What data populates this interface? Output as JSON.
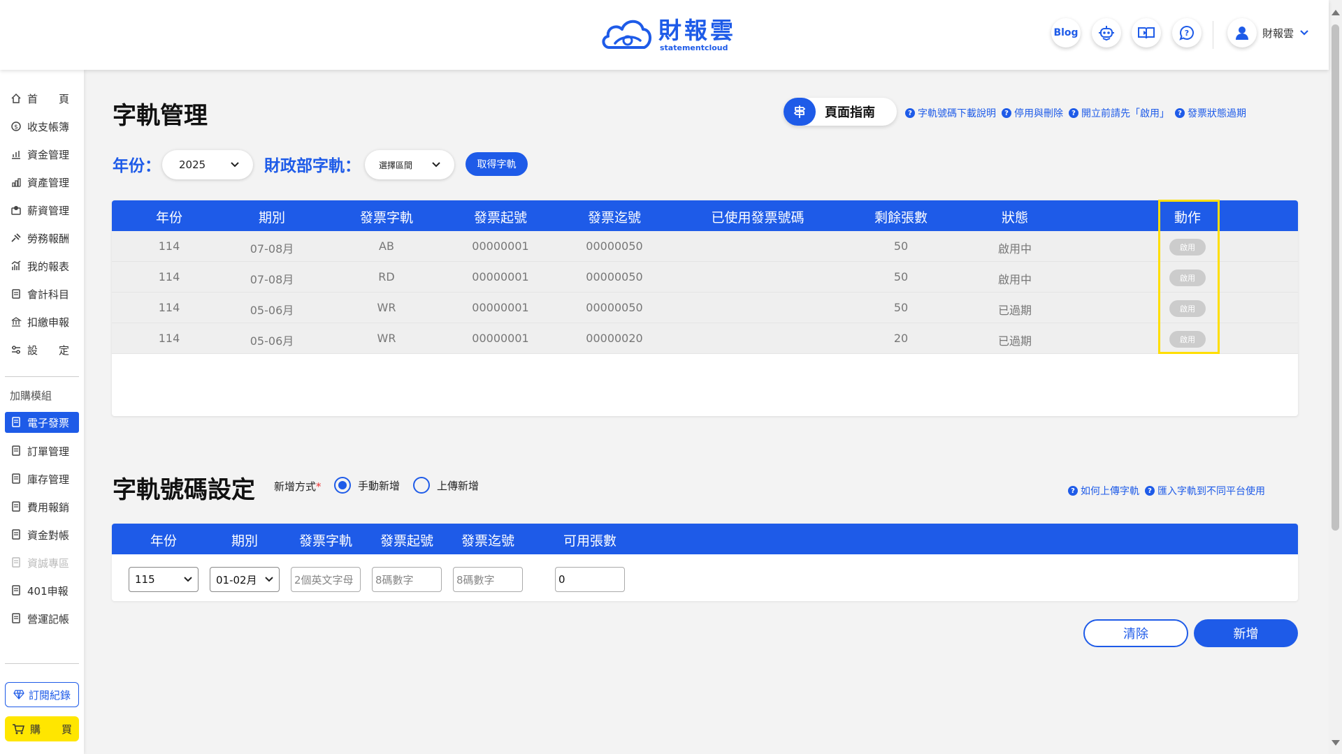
{
  "header": {
    "logo_cn": "財報雲",
    "logo_en": "statementcloud",
    "blog_label": "Blog",
    "user_name": "財報雲"
  },
  "sidebar": {
    "items": [
      {
        "label": "首　　頁",
        "icon": "home-icon"
      },
      {
        "label": "收支帳簿",
        "icon": "coin-icon"
      },
      {
        "label": "資金管理",
        "icon": "funds-icon"
      },
      {
        "label": "資產管理",
        "icon": "asset-icon"
      },
      {
        "label": "薪資管理",
        "icon": "salary-icon"
      },
      {
        "label": "勞務報酬",
        "icon": "labor-icon"
      },
      {
        "label": "我的報表",
        "icon": "report-icon"
      },
      {
        "label": "會計科目",
        "icon": "ledger-icon"
      },
      {
        "label": "扣繳申報",
        "icon": "tax-icon"
      },
      {
        "label": "設　　定",
        "icon": "settings-icon"
      }
    ],
    "addon_label": "加購模組",
    "addons": [
      {
        "label": "電子發票",
        "active": true,
        "disabled": false
      },
      {
        "label": "訂單管理",
        "active": false,
        "disabled": false
      },
      {
        "label": "庫存管理",
        "active": false,
        "disabled": false
      },
      {
        "label": "費用報銷",
        "active": false,
        "disabled": false
      },
      {
        "label": "資金對帳",
        "active": false,
        "disabled": false
      },
      {
        "label": "資誠專區",
        "active": false,
        "disabled": true
      },
      {
        "label": "401申報",
        "active": false,
        "disabled": false
      },
      {
        "label": "營運記帳",
        "active": false,
        "disabled": false
      }
    ],
    "subscription_label": "訂閱紀錄",
    "buy_label": "購　　買"
  },
  "page": {
    "title": "字軌管理",
    "guide_label": "頁面指南",
    "help_links": [
      "字軌號碼下載說明",
      "停用與刪除",
      "開立前請先「啟用」",
      "發票狀態過期"
    ]
  },
  "filters": {
    "year_label": "年份：",
    "year_value": "2025",
    "track_label": "財政部字軌：",
    "track_value": "選擇區間",
    "get_button": "取得字軌"
  },
  "track_table": {
    "headers": [
      "年份",
      "期別",
      "發票字軌",
      "發票起號",
      "發票迄號",
      "已使用發票號碼",
      "剩餘張數",
      "狀態",
      "動作"
    ],
    "rows": [
      {
        "year": "114",
        "period": "07-08月",
        "track": "AB",
        "start": "00000001",
        "end": "00000050",
        "used": "",
        "remaining": "50",
        "status": "啟用中",
        "action": "啟用"
      },
      {
        "year": "114",
        "period": "07-08月",
        "track": "RD",
        "start": "00000001",
        "end": "00000050",
        "used": "",
        "remaining": "50",
        "status": "啟用中",
        "action": "啟用"
      },
      {
        "year": "114",
        "period": "05-06月",
        "track": "WR",
        "start": "00000001",
        "end": "00000050",
        "used": "",
        "remaining": "50",
        "status": "已過期",
        "action": "啟用"
      },
      {
        "year": "114",
        "period": "05-06月",
        "track": "WR",
        "start": "00000001",
        "end": "00000020",
        "used": "",
        "remaining": "20",
        "status": "已過期",
        "action": "啟用"
      }
    ]
  },
  "number_setting": {
    "title": "字軌號碼設定",
    "method_label": "新增方式",
    "methods": [
      "手動新增",
      "上傳新增"
    ],
    "selected_method": "手動新增",
    "help_links": [
      "如何上傳字軌",
      "匯入字軌到不同平台使用"
    ],
    "headers": [
      "年份",
      "期別",
      "發票字軌",
      "發票起號",
      "發票迄號",
      "可用張數"
    ],
    "year_value": "115",
    "period_value": "01-02月",
    "track_placeholder": "2個英文字母",
    "start_placeholder": "8碼數字",
    "end_placeholder": "8碼數字",
    "count_value": "0",
    "clear_button": "清除",
    "add_button": "新增"
  },
  "colors": {
    "primary": "#1e5be8",
    "highlight": "#ffde00",
    "buy": "#ffe600"
  }
}
